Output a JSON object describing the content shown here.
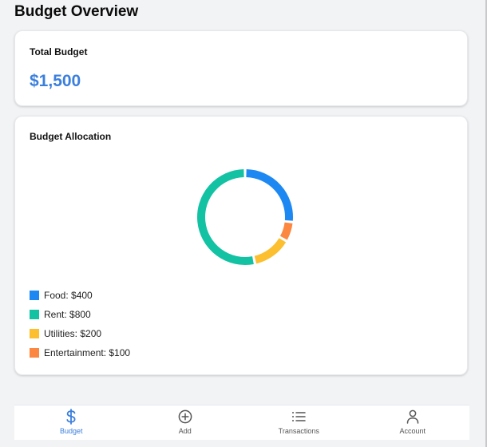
{
  "page": {
    "title": "Budget Overview"
  },
  "total_card": {
    "label": "Total Budget",
    "value": "$1,500"
  },
  "allocation_card": {
    "label": "Budget Allocation",
    "legend": [
      {
        "label": "Food: $400",
        "color": "#1e88f2"
      },
      {
        "label": "Rent: $800",
        "color": "#13c2a3"
      },
      {
        "label": "Utilities: $200",
        "color": "#fbbf2f"
      },
      {
        "label": "Entertainment: $100",
        "color": "#fb8741"
      }
    ]
  },
  "chart_data": {
    "type": "pie",
    "categories": [
      "Food",
      "Entertainment",
      "Utilities",
      "Rent"
    ],
    "values": [
      400,
      100,
      200,
      800
    ],
    "colors": [
      "#1e88f2",
      "#fb8741",
      "#fbbf2f",
      "#13c2a3"
    ],
    "title": "",
    "legend_position": "bottom-left"
  },
  "nav": {
    "items": [
      {
        "label": "Budget",
        "icon": "dollar-icon",
        "active": true
      },
      {
        "label": "Add",
        "icon": "plus-circle-icon",
        "active": false
      },
      {
        "label": "Transactions",
        "icon": "list-icon",
        "active": false
      },
      {
        "label": "Account",
        "icon": "user-icon",
        "active": false
      }
    ]
  }
}
